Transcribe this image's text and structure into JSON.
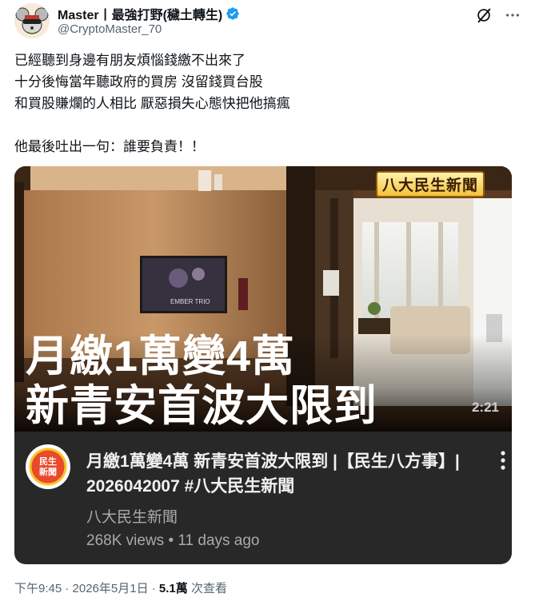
{
  "author": {
    "display_name": "Master丨最強打野(穢土轉生)",
    "handle": "@CryptoMaster_70",
    "verified": true
  },
  "icons": {
    "avatar": "mouse-avatar",
    "verified": "verified-badge-icon",
    "grok": "grok-icon",
    "more": "more-options-icon"
  },
  "tweet": {
    "lines": [
      "已經聽到身邊有朋友煩惱錢繳不出來了",
      "十分後悔當年聽政府的買房 沒留錢買台股",
      "和買股賺爛的人相比 厭惡損失心態快把他搞瘋",
      "他最後吐出一句：誰要負責！！"
    ]
  },
  "video": {
    "thumbnail_logo": "八大民生新聞",
    "headline_line1": "月繳1萬變4萬",
    "headline_line2": "新青安首波大限到",
    "duration": "2:21",
    "tv_text": "EMBER TRIO",
    "title": "月繳1萬變4萬 新青安首波大限到 |【民生八方事】| 2026042007 #八大民生新聞",
    "channel": "八大民生新聞",
    "channel_icon_text": "民生新聞",
    "stats": "268K views • 11 days ago"
  },
  "meta": {
    "timestamp": "下午9:45 · 2026年5月1日 · ",
    "views_count": "5.1萬",
    "views_label": " 次查看"
  },
  "colors": {
    "verified_blue": "#1d9bf0",
    "secondary_text": "#536471",
    "card_background": "#282828"
  }
}
